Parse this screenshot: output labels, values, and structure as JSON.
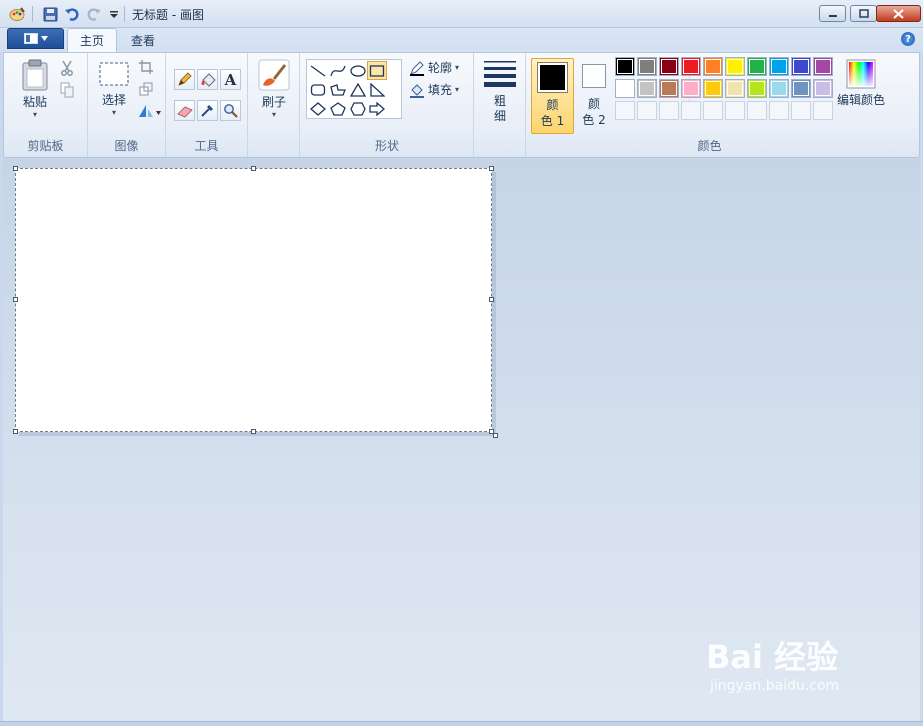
{
  "window": {
    "title": "无标题 - 画图"
  },
  "tabs": {
    "home": "主页",
    "view": "查看"
  },
  "clipboard": {
    "paste": "粘贴",
    "group": "剪贴板"
  },
  "image": {
    "select": "选择",
    "group": "图像"
  },
  "tools": {
    "text_glyph": "A",
    "group": "工具"
  },
  "brushes": {
    "label": "刷子"
  },
  "shapes": {
    "outline": "轮廓",
    "fill": "填充",
    "group": "形状"
  },
  "size": {
    "line1": "粗",
    "line2": "细"
  },
  "colors": {
    "color1_line1": "颜",
    "color1_line2": "色 1",
    "color2_line1": "颜",
    "color2_line2": "色 2",
    "edit": "编辑颜色",
    "group": "颜色",
    "color1_value": "#000000",
    "color2_value": "#ffffff",
    "palette_row1": [
      "#000000",
      "#7f7f7f",
      "#880015",
      "#ed1c24",
      "#ff7f27",
      "#fff200",
      "#22b14c",
      "#00a2e8",
      "#3f48cc",
      "#a349a4"
    ],
    "palette_row2": [
      "#ffffff",
      "#c3c3c3",
      "#b97a57",
      "#ffaec9",
      "#ffc90e",
      "#efe4b0",
      "#b5e61d",
      "#99d9ea",
      "#7092be",
      "#c8bfe7"
    ]
  },
  "watermark": {
    "brand": "Bai 经验",
    "url": "jingyan.baidu.com"
  }
}
